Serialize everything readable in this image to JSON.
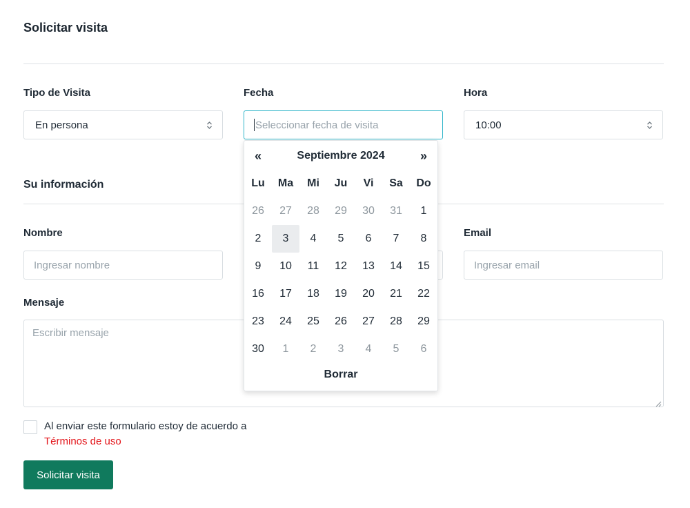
{
  "page": {
    "title": "Solicitar visita"
  },
  "visit_type": {
    "label": "Tipo de Visita",
    "value": "En persona"
  },
  "date": {
    "label": "Fecha",
    "placeholder": "Seleccionar fecha de visita"
  },
  "time": {
    "label": "Hora",
    "value": "10:00"
  },
  "info": {
    "title": "Su información"
  },
  "name": {
    "label": "Nombre",
    "placeholder": "Ingresar nombre"
  },
  "email": {
    "label": "Email",
    "placeholder": "Ingresar email"
  },
  "message": {
    "label": "Mensaje",
    "placeholder": "Escribir mensaje"
  },
  "agreement": {
    "text": "Al enviar este formulario estoy de acuerdo a",
    "link": "Términos de uso"
  },
  "submit": {
    "label": "Solicitar visita"
  },
  "datepicker": {
    "prev": "«",
    "next": "»",
    "month": "Septiembre 2024",
    "weekdays": [
      "Lu",
      "Ma",
      "Mi",
      "Ju",
      "Vi",
      "Sa",
      "Do"
    ],
    "weeks": [
      [
        {
          "d": "26",
          "m": true
        },
        {
          "d": "27",
          "m": true
        },
        {
          "d": "28",
          "m": true
        },
        {
          "d": "29",
          "m": true
        },
        {
          "d": "30",
          "m": true
        },
        {
          "d": "31",
          "m": true
        },
        {
          "d": "1"
        }
      ],
      [
        {
          "d": "2"
        },
        {
          "d": "3",
          "today": true
        },
        {
          "d": "4"
        },
        {
          "d": "5"
        },
        {
          "d": "6"
        },
        {
          "d": "7"
        },
        {
          "d": "8"
        }
      ],
      [
        {
          "d": "9"
        },
        {
          "d": "10"
        },
        {
          "d": "11"
        },
        {
          "d": "12"
        },
        {
          "d": "13"
        },
        {
          "d": "14"
        },
        {
          "d": "15"
        }
      ],
      [
        {
          "d": "16"
        },
        {
          "d": "17"
        },
        {
          "d": "18"
        },
        {
          "d": "19"
        },
        {
          "d": "20"
        },
        {
          "d": "21"
        },
        {
          "d": "22"
        }
      ],
      [
        {
          "d": "23"
        },
        {
          "d": "24"
        },
        {
          "d": "25"
        },
        {
          "d": "26"
        },
        {
          "d": "27"
        },
        {
          "d": "28"
        },
        {
          "d": "29"
        }
      ],
      [
        {
          "d": "30"
        },
        {
          "d": "1",
          "m": true
        },
        {
          "d": "2",
          "m": true
        },
        {
          "d": "3",
          "m": true
        },
        {
          "d": "4",
          "m": true
        },
        {
          "d": "5",
          "m": true
        },
        {
          "d": "6",
          "m": true
        }
      ]
    ],
    "clear": "Borrar"
  },
  "colors": {
    "accent": "#107a5d",
    "link": "#e3151a",
    "focus": "#2bb3c8"
  },
  "icons": [
    "updown-chevron-icon",
    "resize-handle-icon"
  ]
}
